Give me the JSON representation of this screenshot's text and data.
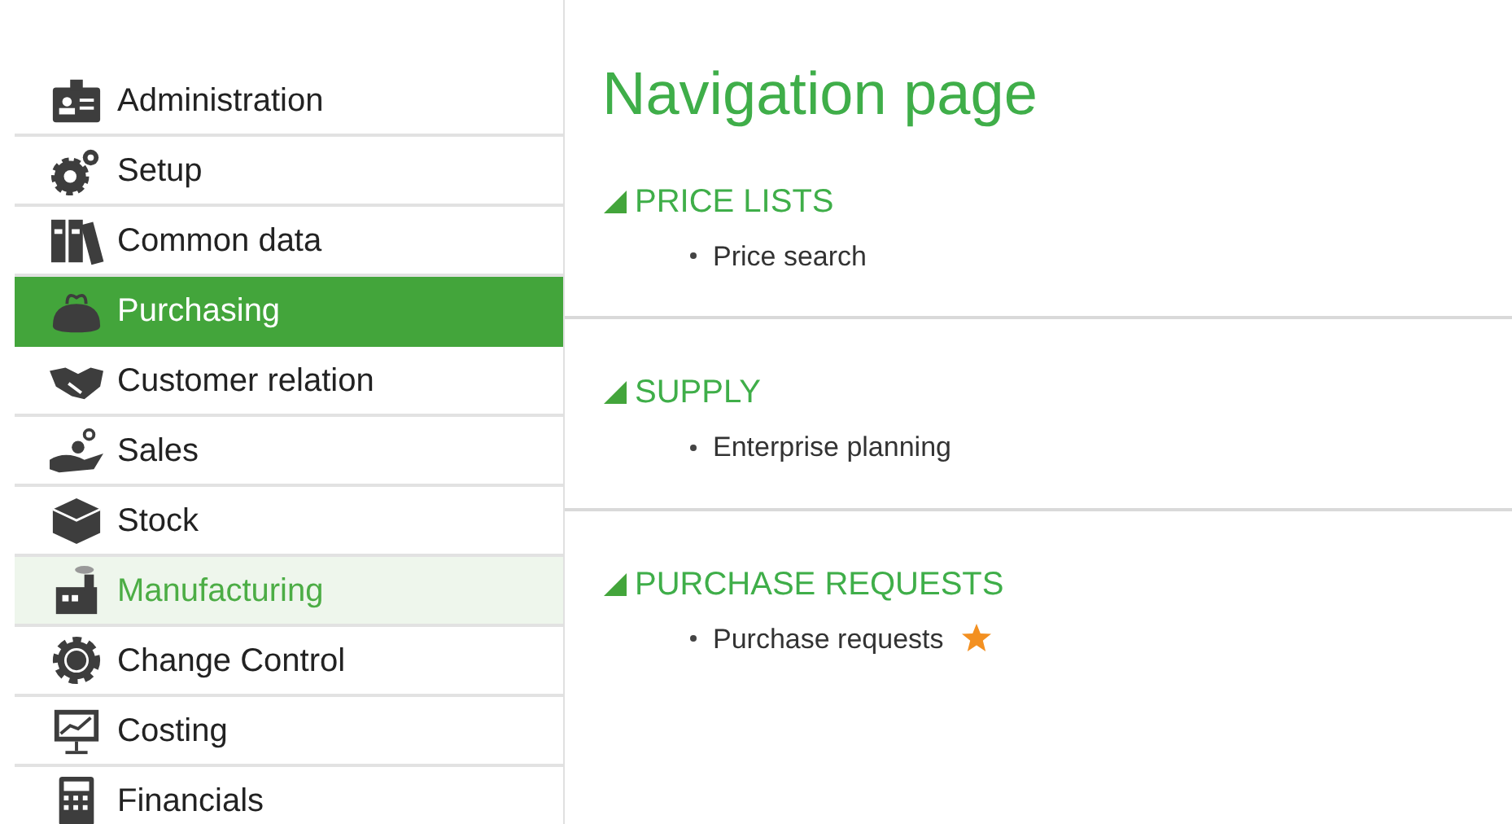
{
  "sidebar": {
    "items": [
      {
        "label": "Administration",
        "selected": false,
        "hovered": false
      },
      {
        "label": "Setup",
        "selected": false,
        "hovered": false
      },
      {
        "label": "Common data",
        "selected": false,
        "hovered": false
      },
      {
        "label": "Purchasing",
        "selected": true,
        "hovered": false
      },
      {
        "label": "Customer relation",
        "selected": false,
        "hovered": false
      },
      {
        "label": "Sales",
        "selected": false,
        "hovered": false
      },
      {
        "label": "Stock",
        "selected": false,
        "hovered": false
      },
      {
        "label": "Manufacturing",
        "selected": false,
        "hovered": true
      },
      {
        "label": "Change Control",
        "selected": false,
        "hovered": false
      },
      {
        "label": "Costing",
        "selected": false,
        "hovered": false
      },
      {
        "label": "Financials",
        "selected": false,
        "hovered": false
      }
    ]
  },
  "main": {
    "title": "Navigation page",
    "sections": [
      {
        "heading": "PRICE LISTS",
        "expanded": true,
        "items": [
          {
            "label": "Price search",
            "favorite": false
          }
        ]
      },
      {
        "heading": "SUPPLY",
        "expanded": true,
        "items": [
          {
            "label": "Enterprise planning",
            "favorite": false
          }
        ]
      },
      {
        "heading": "PURCHASE REQUESTS",
        "expanded": true,
        "items": [
          {
            "label": "Purchase requests",
            "favorite": true
          }
        ]
      }
    ]
  }
}
